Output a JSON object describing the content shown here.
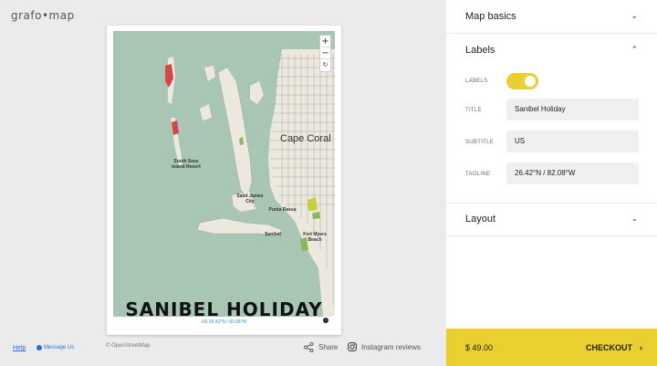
{
  "app": {
    "logo": "grafo•map"
  },
  "poster": {
    "title": "SANIBEL HOLIDAY",
    "tagline": "US 26.42°N / 82.08°W",
    "map_labels": {
      "city": "Cape Coral",
      "south_seas": "South Seas Island Resort",
      "st_james": "Saint James City",
      "punta_rassa": "Punta Rassa",
      "sanibel": "Sanibel",
      "fort_myers": "Fort Myers Beach"
    },
    "zoom": {
      "in": "+",
      "out": "−",
      "reset": "↻"
    },
    "info": "i"
  },
  "footer": {
    "help": "Help",
    "message": "Message Us",
    "attribution": "© OpenStreetMap",
    "share": "Share",
    "instagram": "Instagram reviews"
  },
  "panel": {
    "sections": {
      "map_basics": "Map basics",
      "labels": "Labels",
      "layout": "Layout"
    },
    "labels_toggle_label": "LABELS",
    "labels_on": true,
    "title_label": "TITLE",
    "title_value": "Sanibel Holiday",
    "subtitle_label": "SUBTITLE",
    "subtitle_value": "US",
    "tagline_label": "TAGLINE",
    "tagline_value": "26.42°N / 82.08°W"
  },
  "checkout": {
    "price": "$ 49.00",
    "label": "CHECKOUT"
  },
  "colors": {
    "accent": "#e9cf2f",
    "water": "#a9c6b5",
    "land": "#efece4",
    "link": "#2a6fd6"
  }
}
